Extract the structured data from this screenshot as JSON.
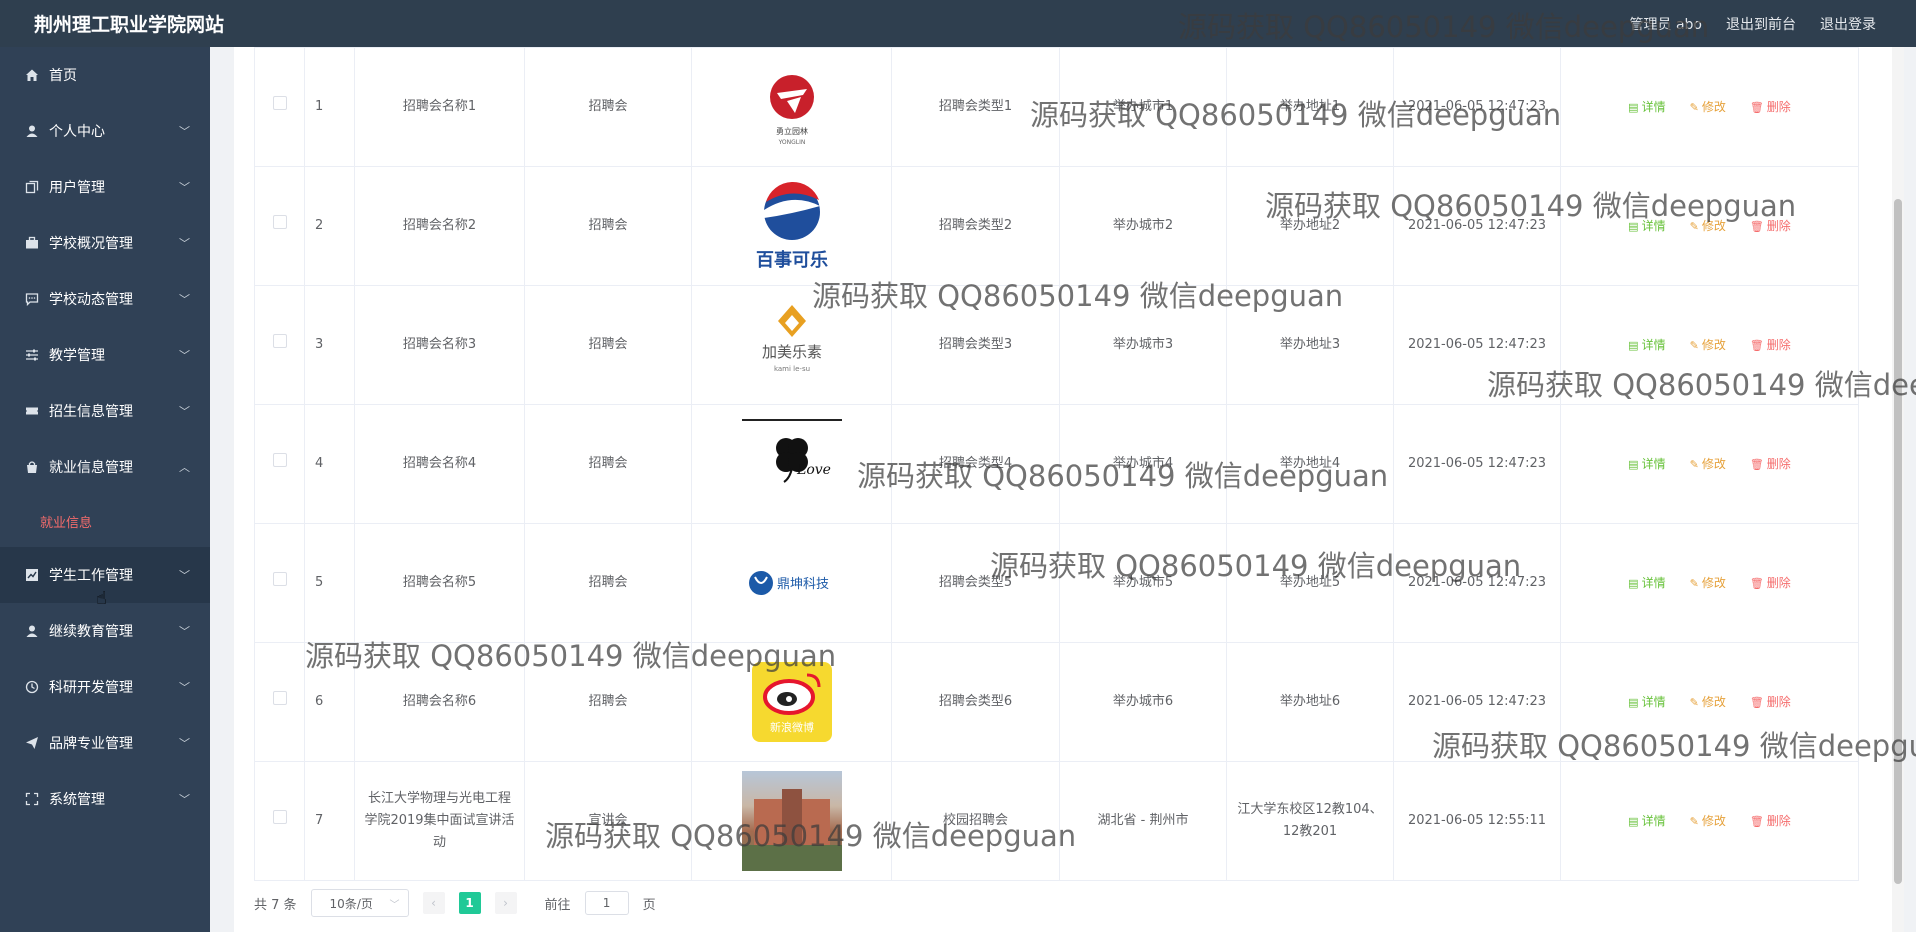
{
  "header": {
    "site_title": "荆州理工职业学院网站",
    "user_label": "管理员 abo",
    "goto_front": "退出到前台",
    "logout": "退出登录"
  },
  "sidebar": {
    "items": [
      {
        "label": "首页",
        "icon": "home-icon"
      },
      {
        "label": "个人中心",
        "icon": "user-icon"
      },
      {
        "label": "用户管理",
        "icon": "copy-icon"
      },
      {
        "label": "学校概况管理",
        "icon": "briefcase-icon"
      },
      {
        "label": "学校动态管理",
        "icon": "chat-icon"
      },
      {
        "label": "教学管理",
        "icon": "sliders-icon"
      },
      {
        "label": "招生信息管理",
        "icon": "ticket-icon"
      },
      {
        "label": "就业信息管理",
        "icon": "bag-icon"
      },
      {
        "label": "学生工作管理",
        "icon": "chart-icon"
      },
      {
        "label": "继续教育管理",
        "icon": "user-icon"
      },
      {
        "label": "科研开发管理",
        "icon": "clock-icon"
      },
      {
        "label": "品牌专业管理",
        "icon": "send-icon"
      },
      {
        "label": "系统管理",
        "icon": "fullscreen-icon"
      }
    ],
    "sub_item": "就业信息"
  },
  "table": {
    "rows": [
      {
        "index": "1",
        "name": "招聘会名称1",
        "category": "招聘会",
        "type": "招聘会类型1",
        "city": "举办城市1",
        "address": "举办地址1",
        "time": "2021-06-05 12:47:23",
        "logo": "yongli-logo"
      },
      {
        "index": "2",
        "name": "招聘会名称2",
        "category": "招聘会",
        "type": "招聘会类型2",
        "city": "举办城市2",
        "address": "举办地址2",
        "time": "2021-06-05 12:47:23",
        "logo": "pepsi-logo"
      },
      {
        "index": "3",
        "name": "招聘会名称3",
        "category": "招聘会",
        "type": "招聘会类型3",
        "city": "举办城市3",
        "address": "举办地址3",
        "time": "2021-06-05 12:47:23",
        "logo": "jiamei-logo"
      },
      {
        "index": "4",
        "name": "招聘会名称4",
        "category": "招聘会",
        "type": "招聘会类型4",
        "city": "举办城市4",
        "address": "举办地址4",
        "time": "2021-06-05 12:47:23",
        "logo": "clover-logo"
      },
      {
        "index": "5",
        "name": "招聘会名称5",
        "category": "招聘会",
        "type": "招聘会类型5",
        "city": "举办城市5",
        "address": "举办地址5",
        "time": "2021-06-05 12:47:23",
        "logo": "dingshen-logo"
      },
      {
        "index": "6",
        "name": "招聘会名称6",
        "category": "招聘会",
        "type": "招聘会类型6",
        "city": "举办城市6",
        "address": "举办地址6",
        "time": "2021-06-05 12:47:23",
        "logo": "weibo-logo"
      },
      {
        "index": "7",
        "name": "长江大学物理与光电工程学院2019集中面试宣讲活动",
        "category": "宣讲会",
        "type": "校园招聘会",
        "city": "湖北省 - 荆州市",
        "address": "江大学东校区12教104、12教201",
        "time": "2021-06-05 12:55:11",
        "logo": "campus-photo"
      }
    ],
    "actions": {
      "detail": "详情",
      "edit": "修改",
      "delete": "删除"
    },
    "logo_texts": {
      "yongli": "YONGLIN",
      "pepsi": "百事可乐",
      "jiamei": "加美乐素",
      "jiamei_sub": "kami le-su",
      "clover": "Love",
      "dingshen": "鼎坤科技",
      "weibo": "新浪微博"
    }
  },
  "pager": {
    "total": "共 7 条",
    "page_size": "10条/页",
    "current": "1",
    "goto_prefix": "前往",
    "goto_value": "1",
    "goto_suffix": "页"
  },
  "watermark": "源码获取 QQ86050149 微信deepguan",
  "colors": {
    "sidebar_bg": "#304156",
    "header_bg": "#2f3f4f",
    "detail": "#67c23a",
    "edit": "#e6a23c",
    "delete": "#f56c6c",
    "active_page": "#20c997"
  }
}
